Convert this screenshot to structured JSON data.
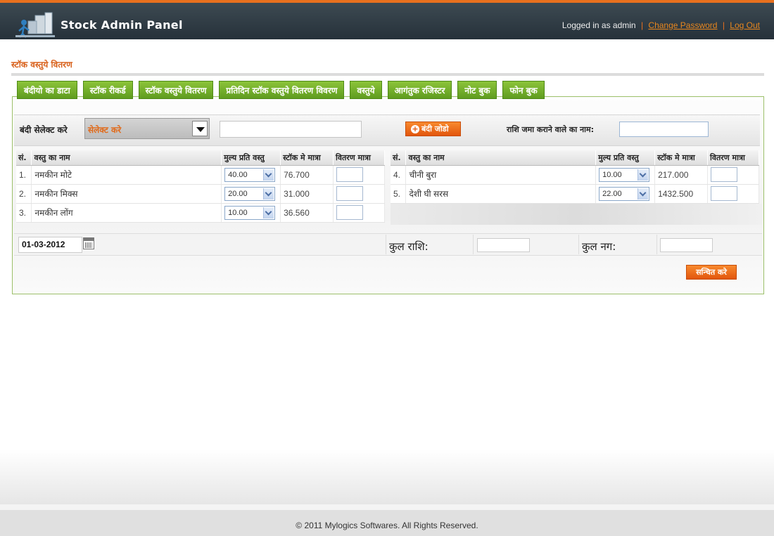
{
  "header": {
    "title": "Stock Admin Panel",
    "logged_in_text": "Logged in as admin",
    "change_password": "Change Password",
    "logout": "Log Out",
    "separator": "|"
  },
  "page": {
    "title": "स्टॉक वस्तुये वितरण"
  },
  "tabs": [
    {
      "label": "बंदीयो का डाटा"
    },
    {
      "label": "स्टॉक रीकर्ड"
    },
    {
      "label": "स्टॉक वस्तुये वितरण"
    },
    {
      "label": "प्रतिदिन स्टॉक वस्तुये वितरण विवरण"
    },
    {
      "label": "वस्तुये"
    },
    {
      "label": "आगंतुक रजिस्टर"
    },
    {
      "label": "नोट बुक"
    },
    {
      "label": "फोन बुक"
    }
  ],
  "select_bar": {
    "label": "बंदी सेलेक्ट करे",
    "dropdown_value": "सेलेक्ट करे",
    "search_value": "",
    "add_button": "बंदी जोडो",
    "depositor_label": "राशि जमा कराने वाले का नाम:",
    "depositor_value": ""
  },
  "table_headers": {
    "sno": "सं.",
    "item": "वस्तु का नाम",
    "price": "मुल्य प्रति वस्तु",
    "stock": "स्टॉक मे मात्रा",
    "qty": "वितरण मात्रा"
  },
  "left_rows": [
    {
      "sno": "1.",
      "item": "नमकीन मोटे",
      "price": "40.00",
      "stock": "76.700",
      "qty": ""
    },
    {
      "sno": "2.",
      "item": "नमकीन मिक्स",
      "price": "20.00",
      "stock": "31.000",
      "qty": ""
    },
    {
      "sno": "3.",
      "item": "नमकीन लोंग",
      "price": "10.00",
      "stock": "36.560",
      "qty": ""
    }
  ],
  "right_rows": [
    {
      "sno": "4.",
      "item": "चीनी बुरा",
      "price": "10.00",
      "stock": "217.000",
      "qty": ""
    },
    {
      "sno": "5.",
      "item": "देशी घी सरस",
      "price": "22.00",
      "stock": "1432.500",
      "qty": ""
    }
  ],
  "totals": {
    "date": "01-03-2012",
    "total_amount_label": "कुल राशि:",
    "total_amount_value": "",
    "total_count_label": "कुल नग:",
    "total_count_value": "",
    "save_button": "सन्चित करे"
  },
  "footer": {
    "text": "© 2011 Mylogics Softwares. All Rights Reserved."
  },
  "colors": {
    "accent": "#e8701e",
    "tab_green": "#6fab28",
    "header_dark": "#2e3a42",
    "button_orange": "#ec6a1c"
  },
  "icons": [
    "logo-icon",
    "plus-circle-icon",
    "calendar-icon",
    "chevron-down-icon"
  ]
}
